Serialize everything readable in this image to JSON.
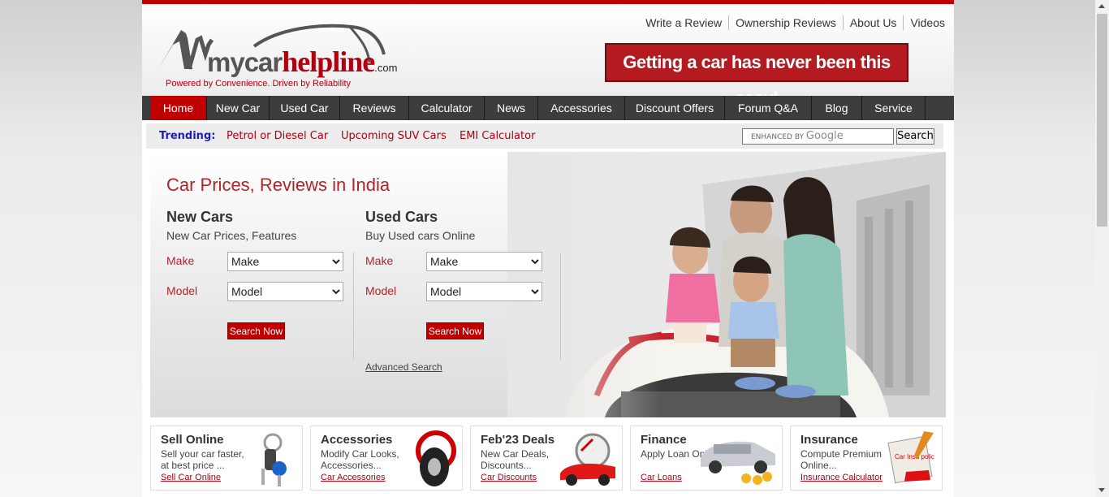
{
  "header": {
    "top_links": [
      "Write a Review",
      "Ownership Reviews",
      "About Us",
      "Videos"
    ],
    "logo": {
      "text_gray": "mycar",
      "text_red": "helpline",
      "suffix": ".com",
      "tagline": "Powered by Convenience. Driven by Reliability"
    },
    "banner": "Getting a car has never been this easy!"
  },
  "nav": {
    "items": [
      "Home",
      "New Car",
      "Used Car",
      "Reviews",
      "Calculator",
      "News",
      "Accessories",
      "Discount Offers",
      "Forum Q&A",
      "Blog",
      "Service"
    ],
    "active": "Home"
  },
  "trending": {
    "label": "Trending:",
    "links": [
      "Petrol or Diesel Car",
      "Upcoming SUV Cars",
      "EMI Calculator"
    ],
    "search_placeholder": "ENHANCED BY",
    "search_brand": "Google",
    "search_button": "Search"
  },
  "hero": {
    "title": "Car Prices, Reviews in India",
    "new_cars": {
      "title": "New Cars",
      "subtitle": "New Car Prices, Features",
      "make_label": "Make",
      "make_value": "Make",
      "model_label": "Model",
      "model_value": "Model",
      "button": "Search Now"
    },
    "used_cars": {
      "title": "Used Cars",
      "subtitle": "Buy Used cars Online",
      "make_label": "Make",
      "make_value": "Make",
      "model_label": "Model",
      "model_value": "Model",
      "button": "Search Now"
    },
    "advanced_search": "Advanced Search"
  },
  "cards": [
    {
      "title": "Sell Online",
      "desc": "Sell your car faster, at best price ...",
      "link": "Sell Car Online",
      "icon": "car-keys-icon"
    },
    {
      "title": "Accessories",
      "desc": "Modify Car Looks, Accessories...",
      "link": "Car Accessories",
      "icon": "tyre-steering-icon"
    },
    {
      "title": "Feb'23 Deals",
      "desc": "New Car Deals, Discounts...",
      "link": "Car Discounts",
      "icon": "red-convertible-icon"
    },
    {
      "title": "Finance",
      "desc": "Apply Loan Online...",
      "link": "Car Loans",
      "icon": "car-coins-icon"
    },
    {
      "title": "Insurance",
      "desc": "Compute Premium Online...",
      "link": "Insurance Calculator",
      "icon": "insurance-policy-icon"
    }
  ],
  "insurance_icon_text": "Car Insu polic",
  "colors": {
    "brand_red": "#c00000",
    "nav_bg": "#3d3d3d",
    "link_red": "#b00010",
    "trending_blue": "#1d1dbb"
  }
}
